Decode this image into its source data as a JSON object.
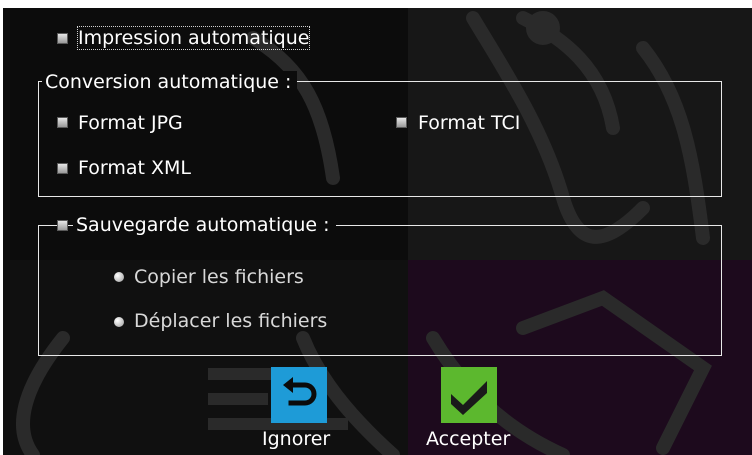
{
  "print": {
    "label": "Impression automatique",
    "checked": false
  },
  "conversion": {
    "legend": "Conversion automatique :",
    "options": [
      {
        "label": "Format JPG",
        "checked": false
      },
      {
        "label": "Format TCI",
        "checked": false
      },
      {
        "label": "Format XML",
        "checked": false
      }
    ]
  },
  "backup": {
    "legend": "Sauvegarde automatique :",
    "checked": false,
    "options": [
      {
        "label": "Copier les fichiers"
      },
      {
        "label": "Déplacer les fichiers"
      }
    ]
  },
  "actions": {
    "ignore_label": "Ignorer",
    "ignore_icon": "undo-arrow-icon",
    "ignore_color": "#1e9bd7",
    "accept_label": "Accepter",
    "accept_icon": "checkmark-icon",
    "accept_color": "#5cb82e"
  }
}
